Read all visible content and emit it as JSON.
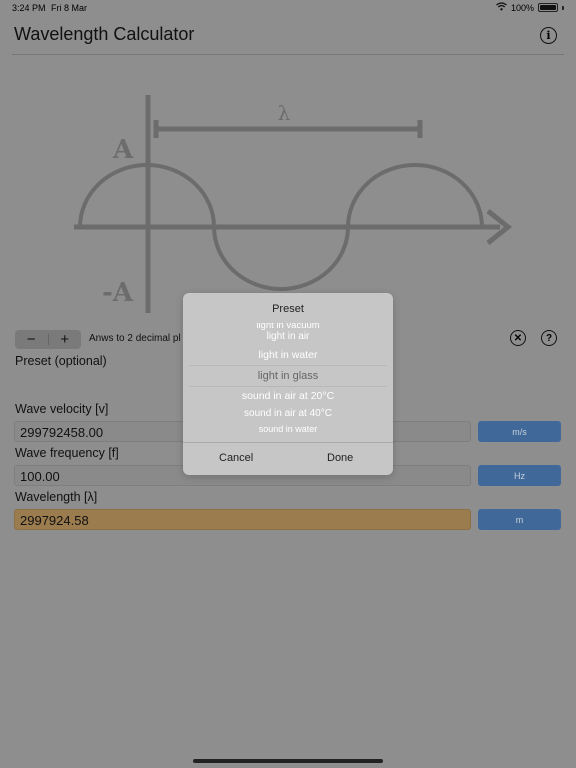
{
  "status_bar": {
    "time": "3:24 PM",
    "date": "Fri 8 Mar",
    "battery": "100%"
  },
  "header": {
    "title": "Wavelength Calculator",
    "info_glyph": "i"
  },
  "diagram": {
    "wavelength_symbol": "λ",
    "amplitude_label": "A",
    "neg_amplitude_label": "-A"
  },
  "precision": {
    "minus": "−",
    "plus": "+",
    "label": "Anws to 2 decimal pl"
  },
  "actions": {
    "clear_glyph": "✕",
    "help_glyph": "?"
  },
  "preset": {
    "label": "Preset (optional)"
  },
  "fields": [
    {
      "label": "Wave velocity [v]",
      "value": "299792458.00",
      "unit": "m/s"
    },
    {
      "label": "Wave frequency [f]",
      "value": "100.00",
      "unit": "Hz"
    },
    {
      "label": "Wavelength [λ]",
      "value": "2997924.58",
      "unit": "m"
    }
  ],
  "modal": {
    "title": "Preset",
    "options": [
      "light in vacuum",
      "light in air",
      "light in water",
      "light in glass",
      "sound in air at 20°C",
      "sound in air at 40°C",
      "sound in water"
    ],
    "selected": "light in glass",
    "cancel": "Cancel",
    "done": "Done"
  },
  "colors": {
    "result_field": "#9b7c4e",
    "unit_button": "#40699a",
    "overlay": "#8e8e8e"
  },
  "icons": [
    "wifi-icon",
    "battery-icon",
    "info-icon",
    "clear-icon",
    "help-icon"
  ]
}
